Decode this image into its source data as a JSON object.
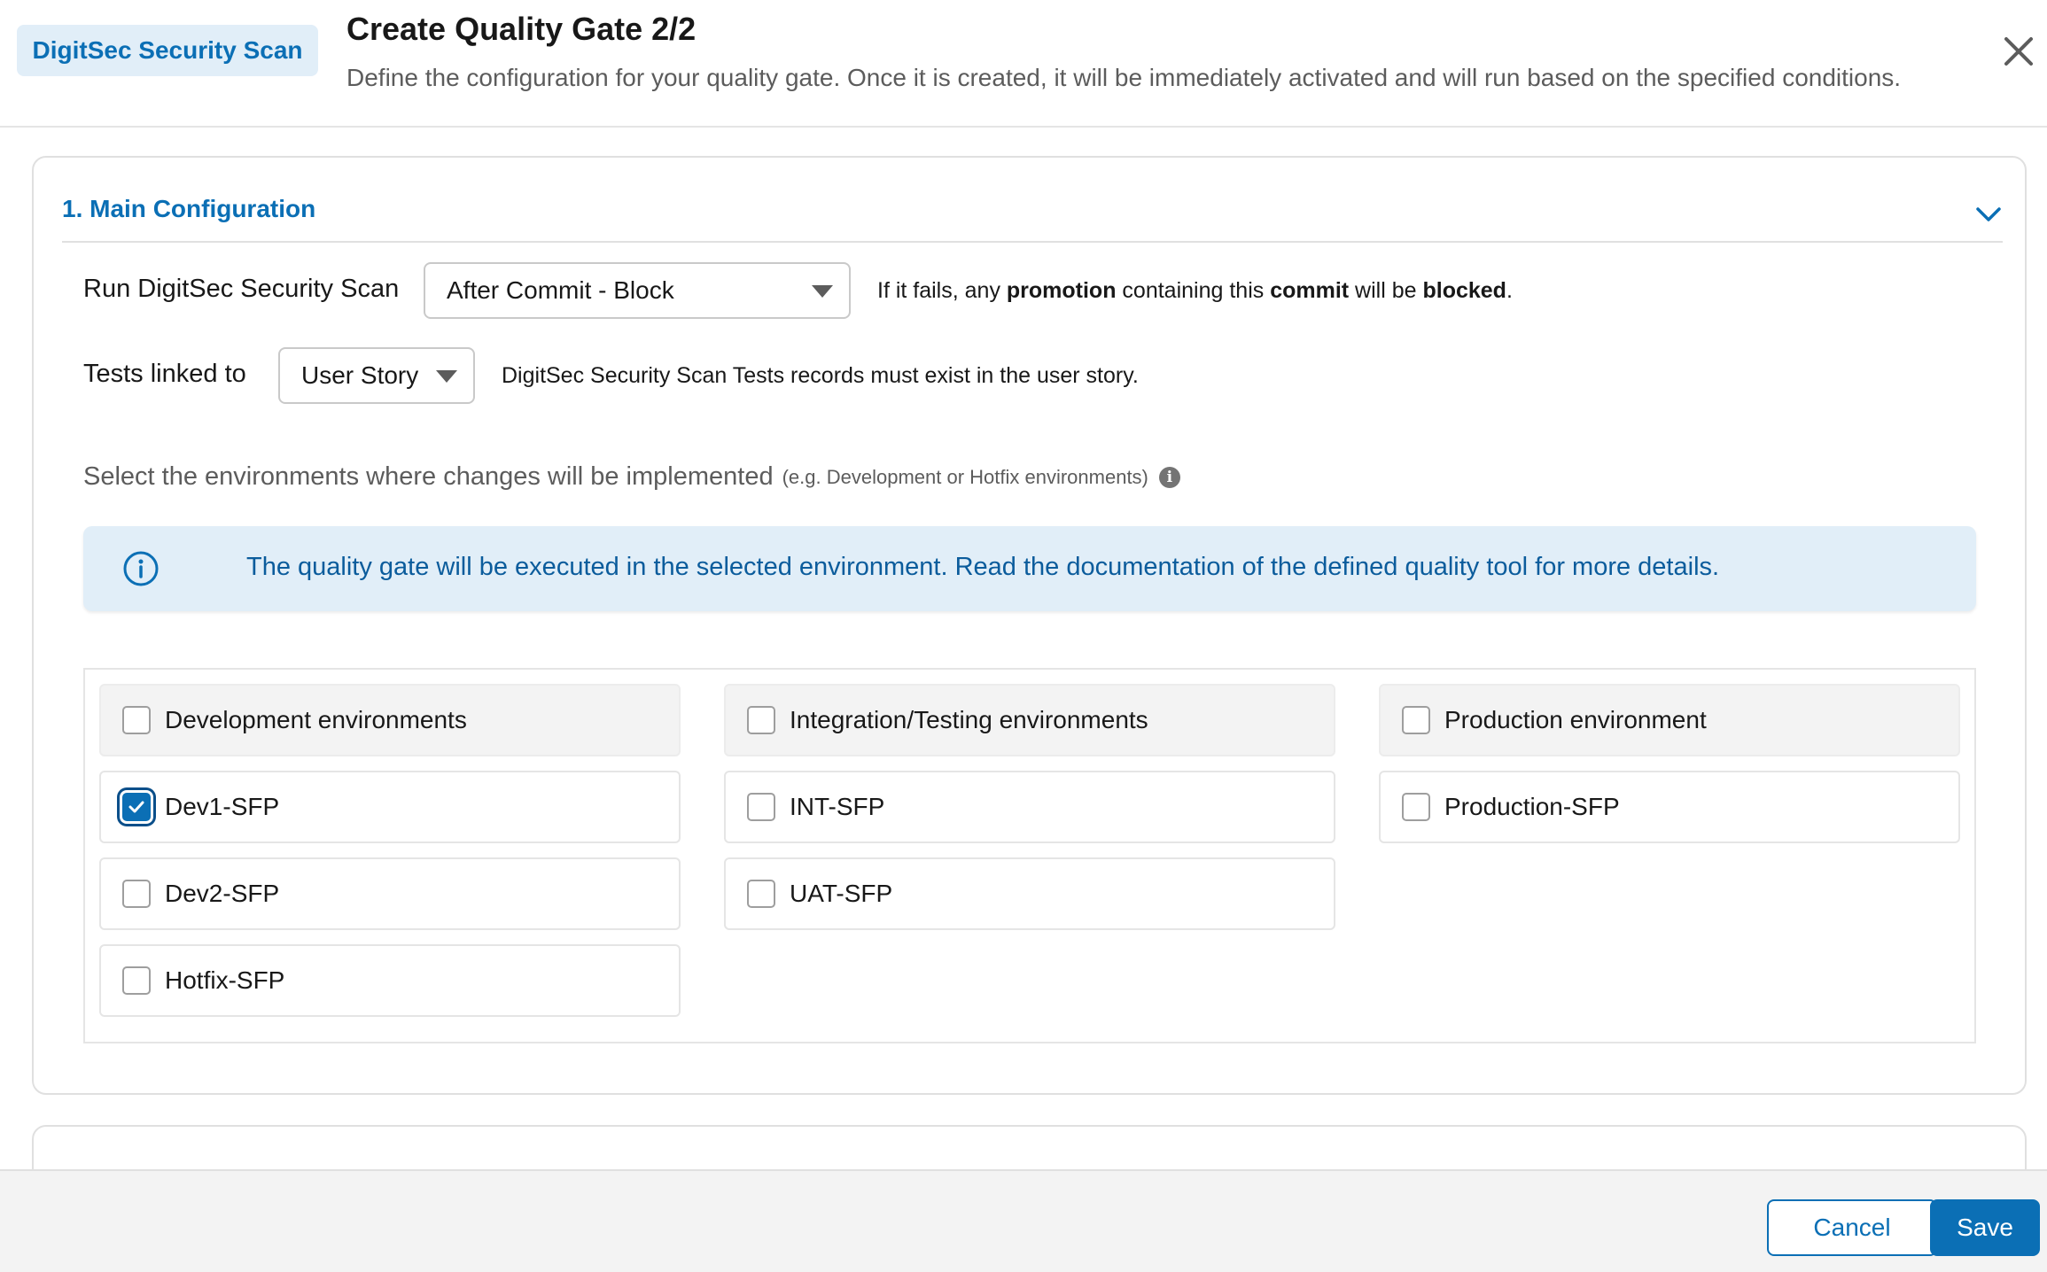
{
  "header": {
    "tool_badge": "DigitSec Security Scan",
    "title": "Create Quality Gate 2/2",
    "subtitle": "Define the configuration for your quality gate. Once it is created, it will be immediately activated and will run based on the specified conditions."
  },
  "main_config": {
    "section_title": "1. Main Configuration",
    "run_label": "Run DigitSec Security Scan",
    "run_value": "After Commit - Block",
    "run_help": {
      "part1": "If it fails, any ",
      "bold1": "promotion",
      "part2": " containing this ",
      "bold2": "commit",
      "part3": " will be ",
      "bold3": "blocked",
      "part4": "."
    },
    "tests_label": "Tests linked to",
    "tests_value": "User Story",
    "tests_help": "DigitSec Security Scan Tests records must exist in the user story.",
    "env_label": "Select the environments where changes will be implemented",
    "env_hint": "(e.g. Development or Hotfix environments)",
    "banner_text": "The quality gate will be executed in the selected environment. Read the documentation of the defined quality tool for more details."
  },
  "environments": {
    "development": {
      "group": "Development environments",
      "items": [
        {
          "label": "Dev1-SFP",
          "checked": true
        },
        {
          "label": "Dev2-SFP",
          "checked": false
        },
        {
          "label": "Hotfix-SFP",
          "checked": false
        }
      ]
    },
    "integration": {
      "group": "Integration/Testing environments",
      "items": [
        {
          "label": "INT-SFP",
          "checked": false
        },
        {
          "label": "UAT-SFP",
          "checked": false
        }
      ]
    },
    "production": {
      "group": "Production environment",
      "items": [
        {
          "label": "Production-SFP",
          "checked": false
        }
      ]
    }
  },
  "footer": {
    "cancel_label": "Cancel",
    "save_label": "Save"
  },
  "icons": {
    "close": "close-icon",
    "chevron": "chevron-down-icon",
    "info": "info-icon",
    "check": "checkmark-icon"
  },
  "colors": {
    "accent": "#0b6fb5",
    "badge_bg": "#e1eef8",
    "banner_text": "#0b5c9c"
  }
}
